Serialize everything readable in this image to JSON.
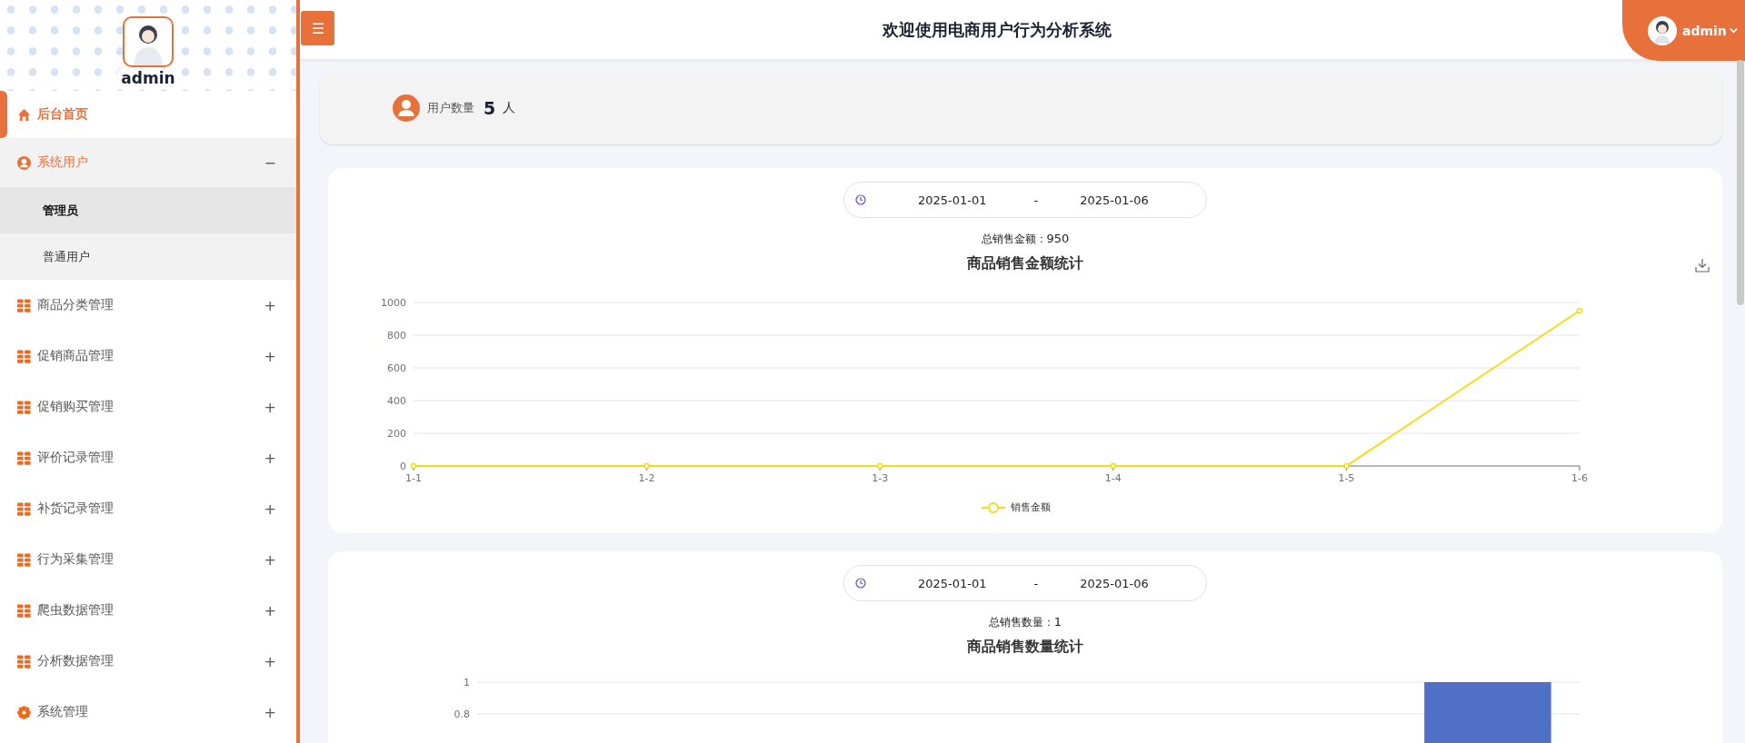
{
  "sidebar": {
    "user_name": "admin",
    "items": [
      {
        "label": "后台首页",
        "selected": true,
        "expanded": false
      },
      {
        "label": "系统用户",
        "selected": false,
        "expanded": true,
        "children": [
          {
            "label": "管理员",
            "hovered": true
          },
          {
            "label": "普通用户",
            "hovered": false
          }
        ]
      },
      {
        "label": "商品分类管理",
        "selected": false,
        "expanded": false
      },
      {
        "label": "促销商品管理",
        "selected": false,
        "expanded": false
      },
      {
        "label": "促销购买管理",
        "selected": false,
        "expanded": false
      },
      {
        "label": "评价记录管理",
        "selected": false,
        "expanded": false
      },
      {
        "label": "补货记录管理",
        "selected": false,
        "expanded": false
      },
      {
        "label": "行为采集管理",
        "selected": false,
        "expanded": false
      },
      {
        "label": "爬虫数据管理",
        "selected": false,
        "expanded": false
      },
      {
        "label": "分析数据管理",
        "selected": false,
        "expanded": false
      },
      {
        "label": "系统管理",
        "selected": false,
        "expanded": false
      }
    ],
    "toggle_expanded": "−",
    "toggle_collapsed": "+"
  },
  "header": {
    "menu_button": "☰",
    "title": "欢迎使用电商用户行为分析系统",
    "user": "admin"
  },
  "stats": {
    "label": "用户数量",
    "value": "5",
    "unit": "人"
  },
  "charts": [
    {
      "date_start": "2025-01-01",
      "separator": "-",
      "date_end": "2025-01-06",
      "total_label": "总销售金额：",
      "total_value": "950",
      "download": true,
      "chart_data": {
        "type": "line",
        "title": "商品销售金额统计",
        "grid": true,
        "categories": [
          "1-1",
          "1-2",
          "1-3",
          "1-4",
          "1-5",
          "1-6"
        ],
        "ylim": [
          0,
          1000
        ],
        "yticks": [
          0,
          200,
          400,
          600,
          800,
          1000
        ],
        "series": [
          {
            "name": "销售金额",
            "color": "#f5dc14",
            "marker": true,
            "values": [
              0,
              0,
              0,
              0,
              0,
              950
            ]
          }
        ]
      }
    },
    {
      "date_start": "2025-01-01",
      "separator": "-",
      "date_end": "2025-01-06",
      "total_label": "总销售数量：",
      "total_value": "1",
      "chart_data": {
        "type": "bar",
        "title": "商品销售数量统计",
        "grid": true,
        "ylim": [
          0,
          1
        ],
        "yticks": [
          {
            "value": 1,
            "label": "1"
          },
          {
            "value": 0.8,
            "label": "0.8"
          }
        ],
        "series": [
          {
            "color": "#5070c8",
            "values": [
              0,
              0,
              0,
              0,
              0,
              1
            ]
          }
        ]
      }
    }
  ]
}
